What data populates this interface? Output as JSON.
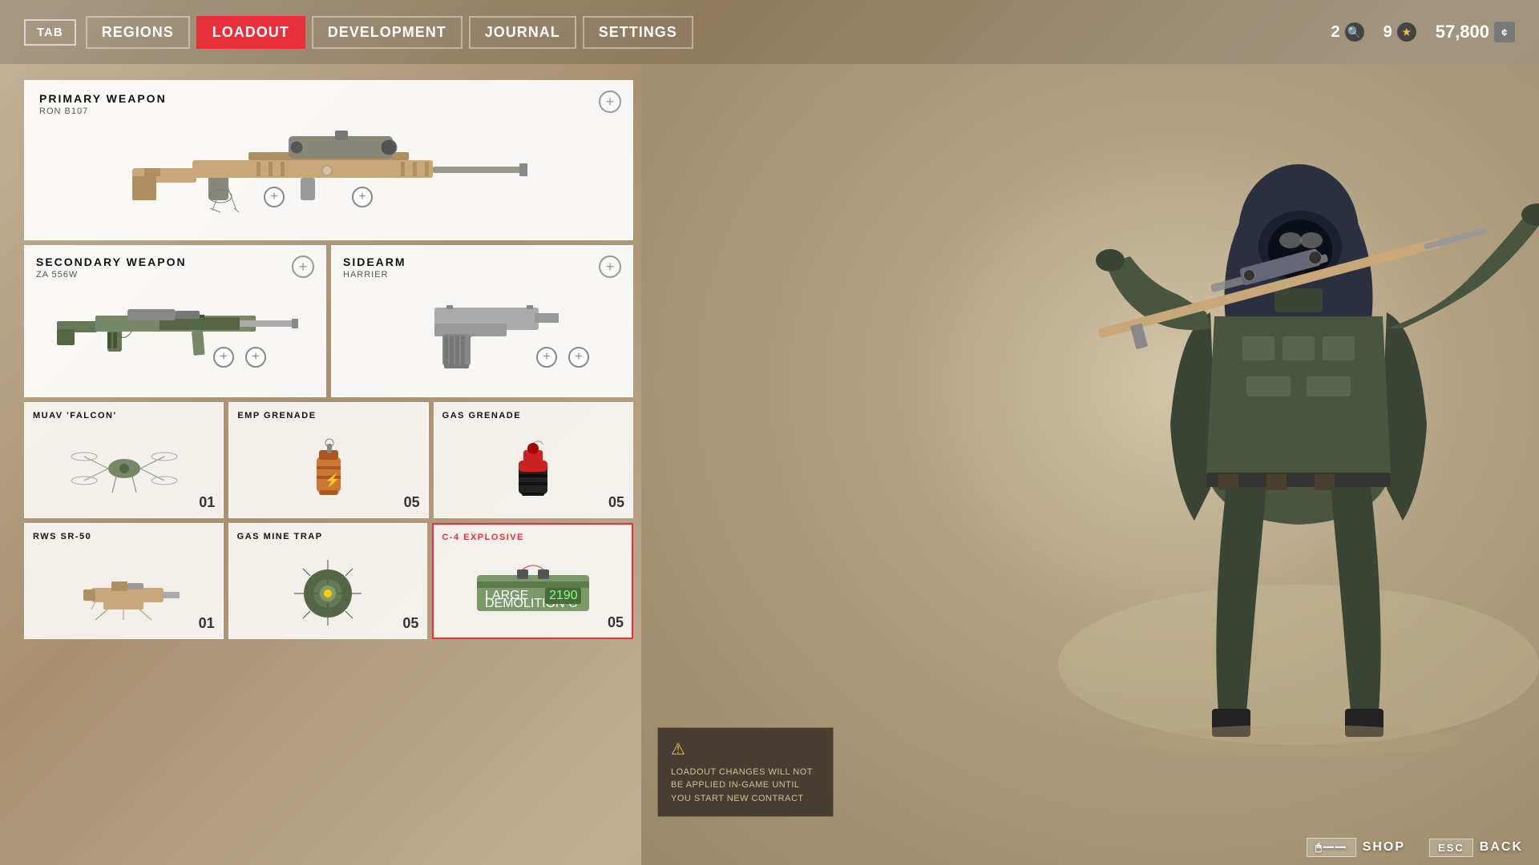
{
  "nav": {
    "tab_key": "TAB",
    "items": [
      {
        "label": "REGIONS",
        "active": false,
        "id": "regions"
      },
      {
        "label": "LOADOUT",
        "active": true,
        "id": "loadout"
      },
      {
        "label": "DEVELOPMENT",
        "active": false,
        "id": "development"
      },
      {
        "label": "JOURNAL",
        "active": false,
        "id": "journal"
      },
      {
        "label": "SETTINGS",
        "active": false,
        "id": "settings"
      }
    ],
    "stats": {
      "intel": "2",
      "stars": "9",
      "currency": "57,800",
      "intel_icon": "🔍",
      "stars_icon": "★",
      "currency_icon": "¢"
    }
  },
  "primary_weapon": {
    "section_label": "PRIMARY WEAPON",
    "weapon_name": "RON B107"
  },
  "secondary_weapon": {
    "section_label": "SECONDARY WEAPON",
    "weapon_name": "ZA 556W"
  },
  "sidearm": {
    "section_label": "SIDEARM",
    "weapon_name": "HARRIER"
  },
  "equipment": [
    {
      "id": "muav-falcon",
      "title": "MUAV 'FALCON'",
      "count": "01",
      "selected": false
    },
    {
      "id": "emp-grenade",
      "title": "EMP GRENADE",
      "count": "05",
      "selected": false
    },
    {
      "id": "gas-grenade",
      "title": "GAS GRENADE",
      "count": "05",
      "selected": false
    }
  ],
  "equipment2": [
    {
      "id": "rws-sr50",
      "title": "RWS SR-50",
      "count": "01",
      "selected": false
    },
    {
      "id": "gas-mine-trap",
      "title": "GAS MINE TRAP",
      "count": "05",
      "selected": false
    },
    {
      "id": "c4-explosive",
      "title": "C-4 EXPLOSIVE",
      "count": "05",
      "selected": true
    }
  ],
  "warning": {
    "text": "LOADOUT CHANGES WILL NOT BE APPLIED IN-GAME UNTIL YOU START NEW CONTRACT"
  },
  "bottom": {
    "shop_label": "SHOP",
    "back_label": "BACK",
    "shop_key": "🖱",
    "back_key": "ESC"
  }
}
